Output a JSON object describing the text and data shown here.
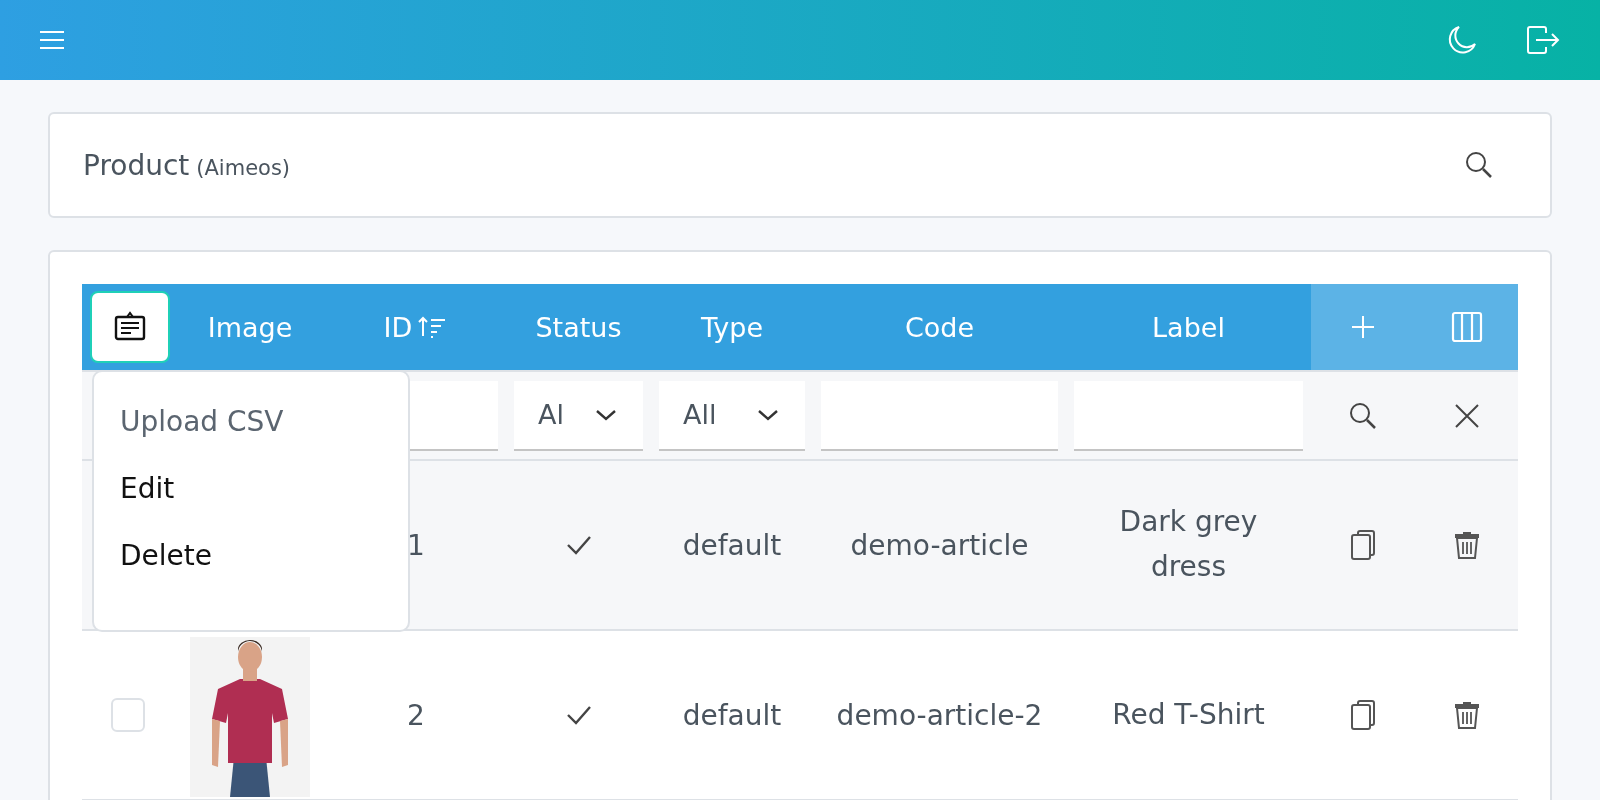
{
  "search_panel": {
    "title": "Product",
    "subtitle": "(Aimeos)"
  },
  "table": {
    "menu_open": true,
    "columns": [
      {
        "label": "Image",
        "sorted": false
      },
      {
        "label": "ID",
        "sorted": true
      },
      {
        "label": "Status",
        "sorted": false
      },
      {
        "label": "Type",
        "sorted": false
      },
      {
        "label": "Code",
        "sorted": false
      },
      {
        "label": "Label",
        "sorted": false
      }
    ],
    "filters": [
      {
        "kind": "text"
      },
      {
        "kind": "select",
        "value": "Al"
      },
      {
        "kind": "select",
        "value": "All"
      },
      {
        "kind": "text"
      },
      {
        "kind": "text"
      }
    ],
    "menu": [
      {
        "label": "Upload CSV",
        "disabled": true
      },
      {
        "label": "Edit",
        "disabled": false
      },
      {
        "label": "Delete",
        "disabled": false
      }
    ],
    "rows": [
      {
        "id": "1",
        "status": true,
        "type": "default",
        "code": "demo-article",
        "label": "Dark grey dress"
      },
      {
        "checked": false,
        "id": "2",
        "status": true,
        "type": "default",
        "code": "demo-article-2",
        "label": "Red T-Shirt"
      }
    ]
  }
}
